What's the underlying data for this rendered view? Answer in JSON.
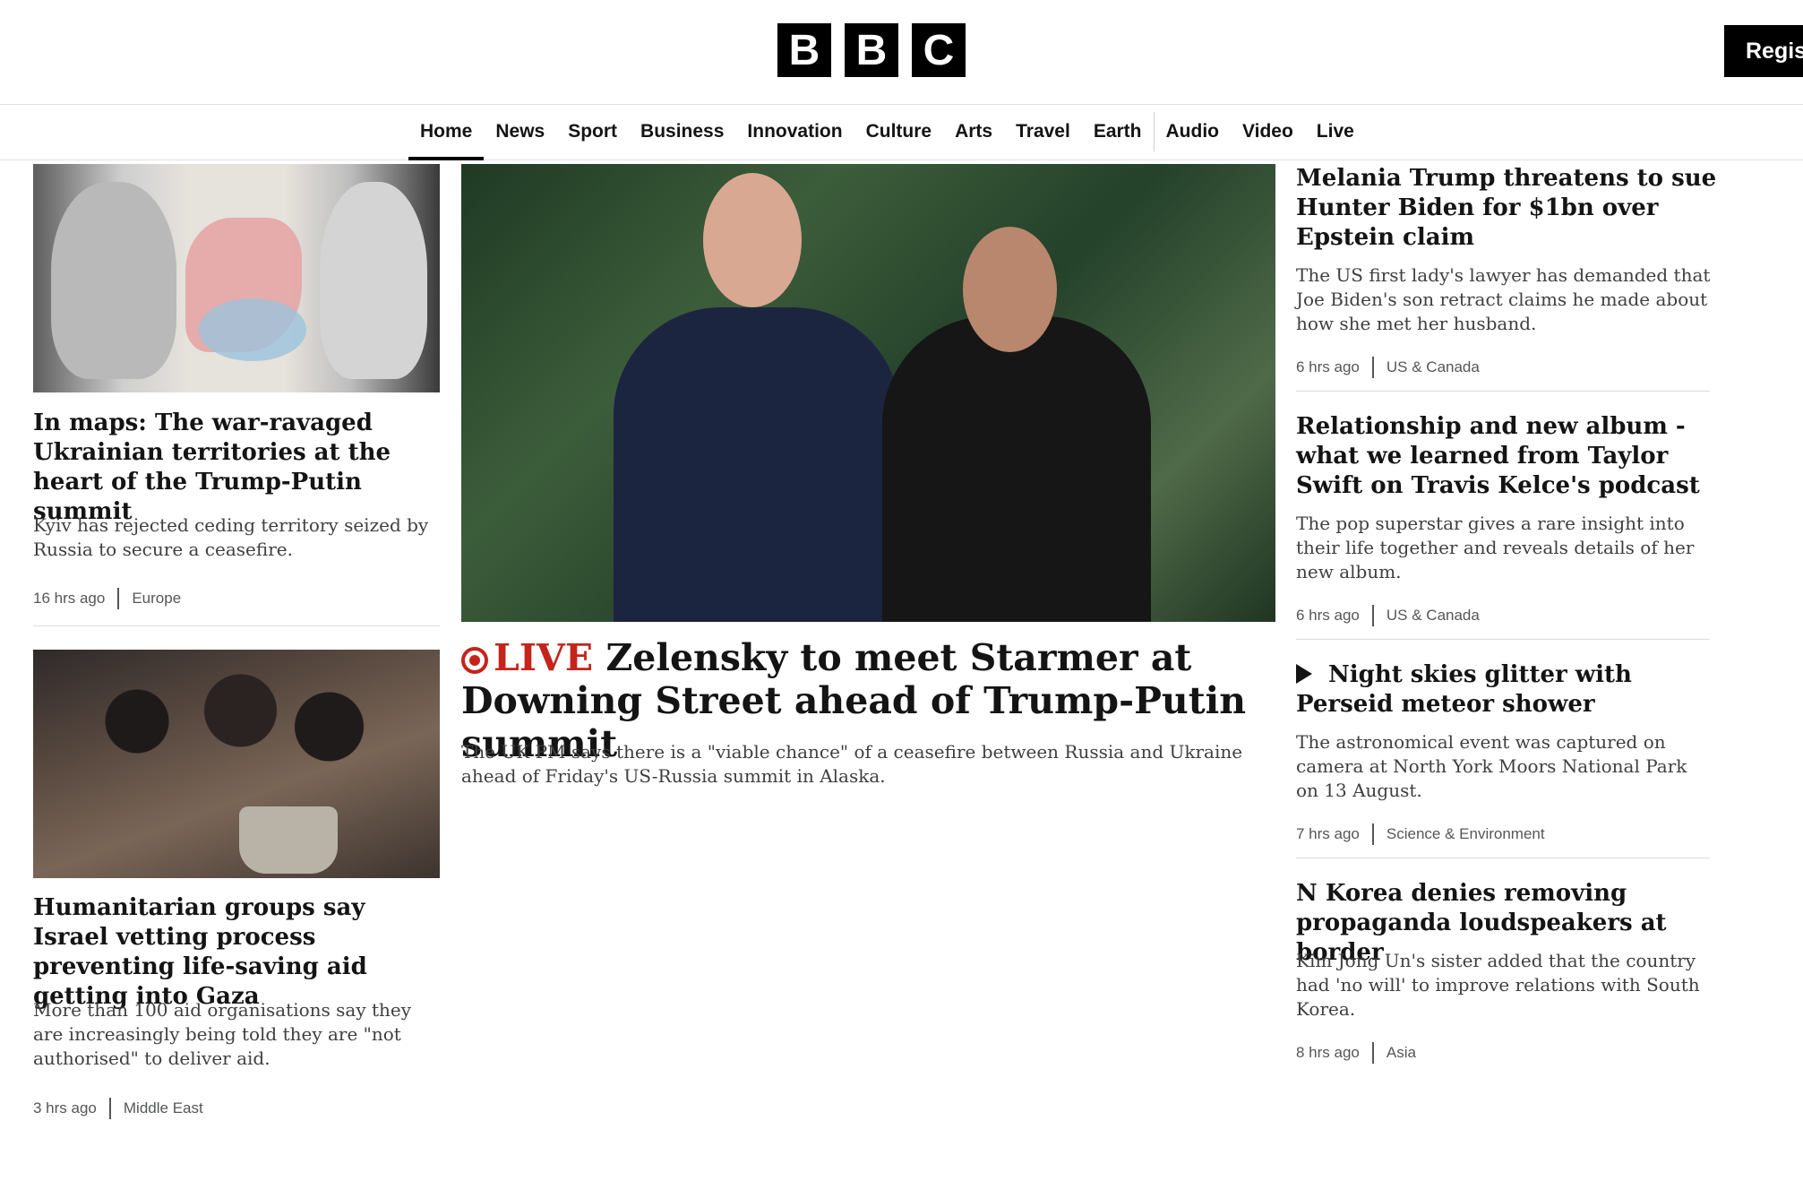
{
  "header": {
    "logo_letters": [
      "B",
      "B",
      "C"
    ],
    "register_label": "Regist"
  },
  "nav": {
    "items": [
      "Home",
      "News",
      "Sport",
      "Business",
      "Innovation",
      "Culture",
      "Arts",
      "Travel",
      "Earth",
      "Audio",
      "Video",
      "Live"
    ],
    "active": "Home"
  },
  "left_column": [
    {
      "headline": "In maps: The war-ravaged Ukrainian territories at the heart of the Trump-Putin summit",
      "summary": "Kyiv has rejected ceding territory seized by Russia to secure a ceasefire.",
      "time": "16 hrs ago",
      "section": "Europe"
    },
    {
      "headline": "Humanitarian groups say Israel vetting process preventing life-saving aid getting into Gaza",
      "summary": "More than 100 aid organisations say they are increasingly being told they are \"not authorised\" to deliver aid.",
      "time": "3 hrs ago",
      "section": "Middle East"
    }
  ],
  "hero": {
    "live_label": "LIVE",
    "headline": "Zelensky to meet Starmer at Downing Street ahead of Trump-Putin summit",
    "summary": "The UK PM says there is a \"viable chance\" of a ceasefire between Russia and Ukraine ahead of Friday's US-Russia summit in Alaska."
  },
  "right_column": [
    {
      "headline": "Melania Trump threatens to sue Hunter Biden for $1bn over Epstein claim",
      "summary": "The US first lady's lawyer has demanded that Joe Biden's son retract claims he made about how she met her husband.",
      "time": "6 hrs ago",
      "section": "US & Canada"
    },
    {
      "headline": "Relationship and new album - what we learned from Taylor Swift on Travis Kelce's podcast",
      "summary": "The pop superstar gives a rare insight into their life together and reveals details of her new album.",
      "time": "6 hrs ago",
      "section": "US & Canada"
    },
    {
      "headline": "Night skies glitter with Perseid meteor shower",
      "summary": "The astronomical event was captured on camera at North York Moors National Park on 13 August.",
      "time": "7 hrs ago",
      "section": "Science & Environment"
    },
    {
      "headline": "N Korea denies removing propaganda loudspeakers at border",
      "summary": "Kim Jong Un's sister added that the country had 'no will' to improve relations with South Korea.",
      "time": "8 hrs ago",
      "section": "Asia"
    }
  ]
}
